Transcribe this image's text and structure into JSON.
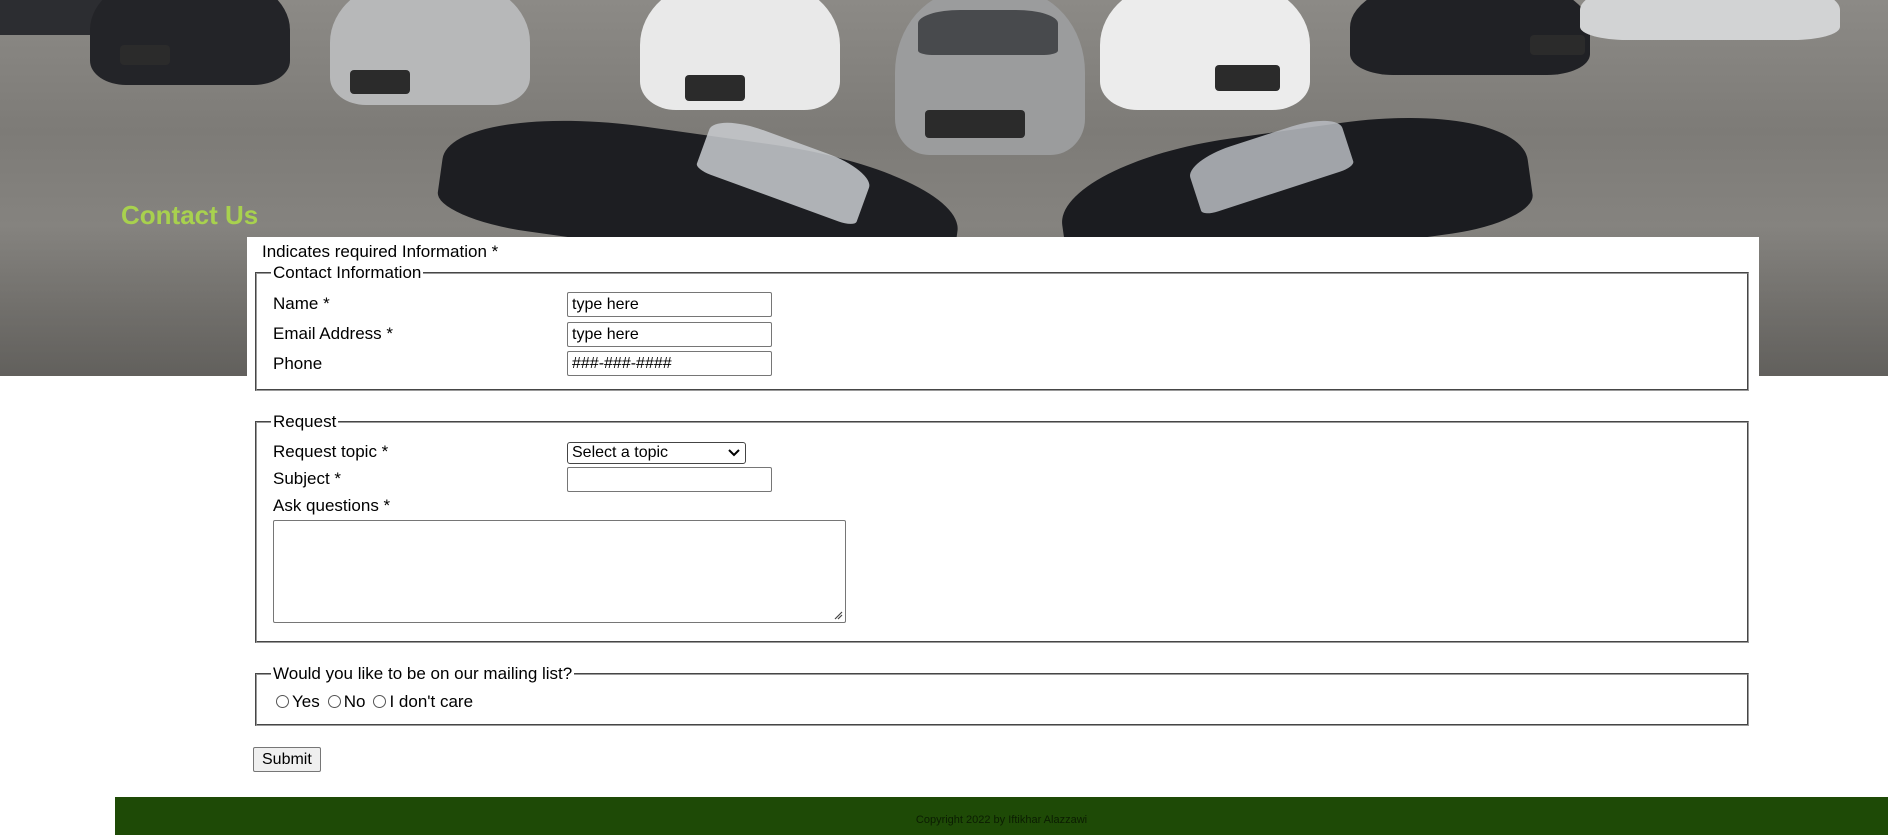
{
  "header": {
    "page_title": "Contact Us"
  },
  "form": {
    "required_note": "Indicates required Information *",
    "contact": {
      "legend": "Contact Information",
      "name_label": "Name *",
      "name_placeholder": "type here",
      "email_label": "Email Address *",
      "email_placeholder": "type here",
      "phone_label": "Phone",
      "phone_placeholder": "###-###-####"
    },
    "request": {
      "legend": "Request",
      "topic_label": "Request topic *",
      "topic_selected": "Select a topic",
      "subject_label": "Subject *",
      "subject_value": "",
      "questions_label": "Ask questions *"
    },
    "mailing": {
      "legend": "Would you like to be on our mailing list?",
      "options": [
        "Yes",
        "No",
        "I don't care"
      ]
    },
    "submit_label": "Submit"
  },
  "footer": {
    "copyright": "Copyright 2022 by Iftikhar Alazzawi"
  },
  "colors": {
    "title": "#a8d14e",
    "footer_bg": "#1e4a06"
  }
}
